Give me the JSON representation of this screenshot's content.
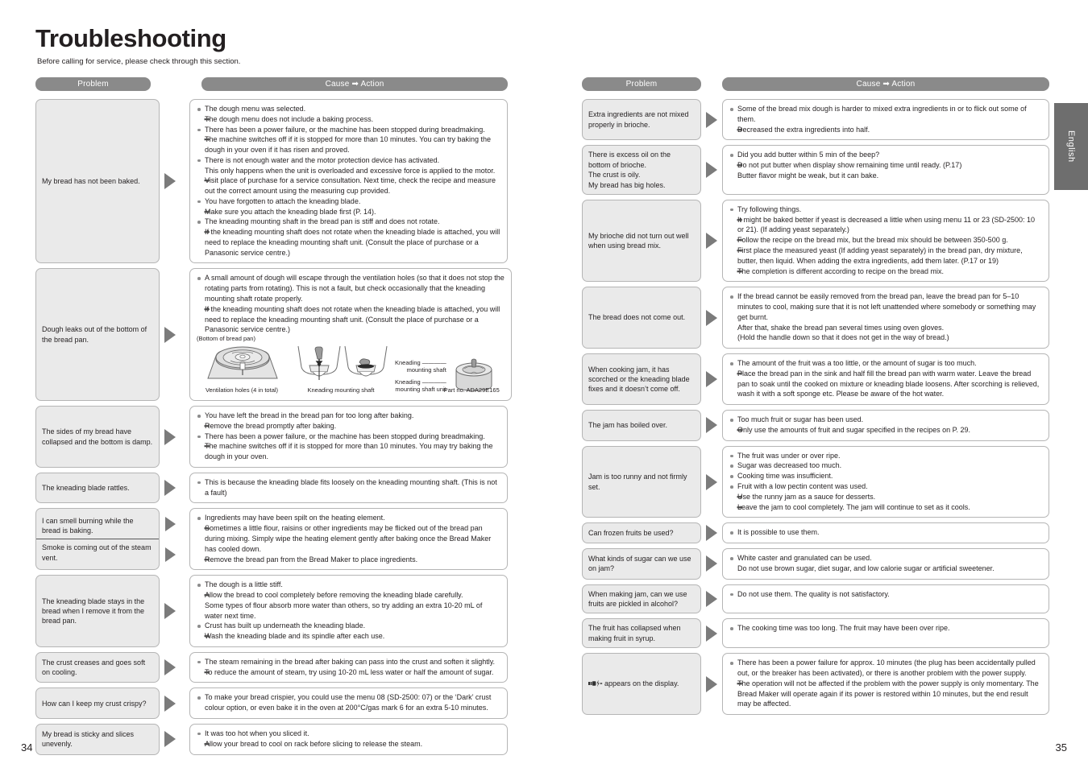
{
  "title": "Troubleshooting",
  "subtitle": "Before calling for service, please check through this section.",
  "lang_tab": "English",
  "headers": {
    "problem": "Problem",
    "cause": "Cause ➡ Action"
  },
  "page_numbers": {
    "left": "34",
    "right": "35"
  },
  "colors": {
    "header_bar": "#8a8a8a",
    "problem_box": "#eaeaea",
    "arrow": "#7b7b7b",
    "border": "#b5b5b5",
    "tab": "#6e6e6e"
  },
  "left_rows": [
    {
      "problem": [
        "My bread has not been baked."
      ],
      "items": [
        {
          "type": "cause",
          "text": "The dough menu was selected."
        },
        {
          "type": "action",
          "text": "The dough menu does not include a baking process."
        },
        {
          "type": "cause",
          "text": "There has been a power failure, or the machine has been stopped during breadmaking."
        },
        {
          "type": "action",
          "text": "The machine switches off if it is stopped for more than 10 minutes. You can try baking the dough in your oven if it has risen and proved."
        },
        {
          "type": "cause",
          "text": "There is not enough water and the motor protection device has activated."
        },
        {
          "type": "cont",
          "text": "This only happens when the unit is overloaded and excessive force is applied to the motor."
        },
        {
          "type": "action",
          "text": "Visit place of purchase for a service consultation. Next time, check the recipe and measure out the correct amount using the measuring cup provided."
        },
        {
          "type": "cause",
          "text": "You have forgotten to attach the kneading blade."
        },
        {
          "type": "action",
          "text": "Make sure you attach the kneading blade first (P. 14)."
        },
        {
          "type": "cause",
          "text": "The kneading mounting shaft in the bread pan is stiff and does not rotate."
        },
        {
          "type": "action",
          "text": "If the kneading mounting shaft does not rotate when the kneading blade is attached, you will need to replace the kneading mounting shaft unit. (Consult the place of purchase or a Panasonic service centre.)"
        }
      ]
    },
    {
      "problem": [
        "Dough leaks out of the bottom of the bread pan."
      ],
      "items": [
        {
          "type": "cause",
          "text": "A small amount of dough will escape through the ventilation holes (so that it does not stop the rotating parts from rotating). This is not a fault, but check occasionally that the kneading mounting shaft rotate properly."
        },
        {
          "type": "action",
          "text": "If the kneading mounting shaft does not rotate when the kneading blade is attached, you will need to replace the kneading mounting shaft unit. (Consult the place of purchase or a Panasonic service centre.)"
        }
      ],
      "figure": {
        "caption_top": "(Bottom of bread pan)",
        "label_1": "Ventilation holes (4 in total)",
        "label_2": "Kneading mounting shaft",
        "callout_1": "Kneading mounting shaft",
        "callout_2": "Kneading mounting shaft unit",
        "part_no": "Part no. ADA29E165"
      }
    },
    {
      "problem": [
        "The sides of my bread have collapsed and the bottom is damp."
      ],
      "items": [
        {
          "type": "cause",
          "text": "You have left the bread in the bread pan for too long after baking."
        },
        {
          "type": "action",
          "text": "Remove the bread promptly after baking."
        },
        {
          "type": "cause",
          "text": "There has been a power failure, or the machine has been stopped during breadmaking."
        },
        {
          "type": "action",
          "text": "The machine switches off if it is stopped for more than 10 minutes. You may try baking the dough in your oven."
        }
      ]
    },
    {
      "problem": [
        "The kneading blade rattles."
      ],
      "items": [
        {
          "type": "cause",
          "text": "This is because the kneading blade fits loosely on the kneading mounting shaft. (This is not a fault)"
        }
      ]
    },
    {
      "problem": [
        "I can smell burning while the bread is baking.",
        "Smoke is coming out of the steam vent."
      ],
      "split": true,
      "items": [
        {
          "type": "cause",
          "text": "Ingredients may have been spilt on the heating element."
        },
        {
          "type": "action",
          "text": "Sometimes a little flour, raisins or other ingredients may be flicked out of the bread pan during mixing. Simply wipe the heating element gently after baking once the Bread Maker has cooled down."
        },
        {
          "type": "action",
          "text": "Remove the bread pan from the Bread Maker to place ingredients."
        }
      ]
    },
    {
      "problem": [
        "The kneading blade stays in the bread when I remove it from the bread pan."
      ],
      "items": [
        {
          "type": "cause",
          "text": "The dough is a little stiff."
        },
        {
          "type": "action",
          "text": "Allow the bread to cool completely before removing the kneading blade carefully."
        },
        {
          "type": "actcont",
          "text": "Some types of flour absorb more water than others, so try adding an extra 10-20 mL of water next time."
        },
        {
          "type": "cause",
          "text": "Crust has built up underneath the kneading blade."
        },
        {
          "type": "action",
          "text": "Wash the kneading blade and its spindle after each use."
        }
      ]
    },
    {
      "problem": [
        "The crust creases and goes soft on cooling."
      ],
      "items": [
        {
          "type": "cause",
          "text": "The steam remaining in the bread after baking can pass into the crust and soften it slightly."
        },
        {
          "type": "action",
          "text": "To reduce the amount of steam, try using 10-20 mL less water or half the amount of sugar."
        }
      ]
    },
    {
      "problem": [
        "How can I keep my crust crispy?"
      ],
      "items": [
        {
          "type": "cause",
          "text": "To make your bread crispier, you could use the menu 08 (SD-2500: 07) or the ‘Dark’ crust colour option, or even bake it in the oven at 200°C/gas mark 6 for an extra 5-10 minutes."
        }
      ]
    },
    {
      "problem": [
        "My bread is sticky and slices unevenly."
      ],
      "items": [
        {
          "type": "cause",
          "text": "It was too hot when you sliced it."
        },
        {
          "type": "action",
          "text": "Allow your bread to cool on rack before slicing to release the steam."
        }
      ]
    }
  ],
  "right_rows": [
    {
      "problem": [
        "Extra ingredients are not mixed properly in brioche."
      ],
      "items": [
        {
          "type": "cause",
          "text": "Some of the bread mix dough is harder to mixed extra ingredients in or to flick out some of them."
        },
        {
          "type": "action",
          "text": "Decreased the extra ingredients into half."
        }
      ]
    },
    {
      "problem": [
        "There is excess oil on the bottom of brioche.",
        "The crust is oily.",
        "My bread has big holes."
      ],
      "multiline": true,
      "items": [
        {
          "type": "cause",
          "text": "Did you add butter within 5 min of the beep?"
        },
        {
          "type": "action",
          "text": "Do not put butter when display show remaining time until ready. (P.17)"
        },
        {
          "type": "actcont",
          "text": "Butter flavor might be weak, but it can bake."
        }
      ]
    },
    {
      "problem": [
        "My brioche did not turn out well when using bread mix."
      ],
      "items": [
        {
          "type": "cause",
          "text": "Try following things."
        },
        {
          "type": "action",
          "text": "It might be baked better if yeast is decreased a little when using menu 11 or 23 (SD-2500: 10 or 21). (If adding yeast separately.)"
        },
        {
          "type": "action",
          "text": "Follow the recipe on the bread mix, but the bread mix should be between 350-500 g."
        },
        {
          "type": "action",
          "text": "First place the measured yeast (If adding yeast separately) in the bread pan, dry mixture, butter, then liquid. When adding the extra ingredients, add them later. (P.17 or 19)"
        },
        {
          "type": "action",
          "text": "The completion is different according to recipe on the bread mix."
        }
      ]
    },
    {
      "problem": [
        "The bread does not come out."
      ],
      "items": [
        {
          "type": "cause",
          "text": "If the bread cannot be easily removed from the bread pan, leave the bread pan for 5–10 minutes to cool, making sure that it is not left unattended where somebody or something may get burnt."
        },
        {
          "type": "cont",
          "text": "After that, shake the bread pan several times using oven gloves."
        },
        {
          "type": "cont",
          "text": "(Hold the handle down so that it does not get in the way of bread.)"
        }
      ]
    },
    {
      "problem": [
        "When cooking jam, it has scorched or the kneading blade fixes and it doesn’t come off."
      ],
      "items": [
        {
          "type": "cause",
          "text": "The amount of the fruit was a too little, or the amount of sugar is too much."
        },
        {
          "type": "action",
          "text": "Place the bread pan in the sink and half fill the bread pan with warm water. Leave the bread pan to soak until the cooked on mixture or kneading blade loosens. After scorching is relieved, wash it with a soft sponge etc. Please be aware of the hot water."
        }
      ]
    },
    {
      "problem": [
        "The jam has boiled over."
      ],
      "items": [
        {
          "type": "cause",
          "text": "Too much fruit or sugar has been used."
        },
        {
          "type": "action",
          "text": "Only use the amounts of fruit and sugar specified in the recipes on P. 29."
        }
      ]
    },
    {
      "problem": [
        "Jam is too runny and not firmly set."
      ],
      "items": [
        {
          "type": "cause",
          "text": "The fruit was under or over ripe."
        },
        {
          "type": "cause",
          "text": "Sugar was decreased too much."
        },
        {
          "type": "cause",
          "text": "Cooking time was insufficient."
        },
        {
          "type": "cause",
          "text": "Fruit with a low pectin content was used."
        },
        {
          "type": "action",
          "text": "Use the runny jam as a sauce for desserts."
        },
        {
          "type": "action",
          "text": "Leave the jam to cool completely. The jam will continue to set as it cools."
        }
      ]
    },
    {
      "problem": [
        "Can frozen fruits be used?"
      ],
      "items": [
        {
          "type": "cause",
          "text": "It is possible to use them."
        }
      ]
    },
    {
      "problem": [
        "What kinds of sugar can we use on jam?"
      ],
      "items": [
        {
          "type": "cause",
          "text": "White caster and granulated can be used."
        },
        {
          "type": "cont",
          "text": "Do not use brown sugar, diet sugar, and low calorie sugar or artificial sweetener."
        }
      ]
    },
    {
      "problem": [
        "When making jam, can we use fruits are pickled in alcohol?"
      ],
      "items": [
        {
          "type": "cause",
          "text": "Do not use them. The quality is not satisfactory."
        }
      ]
    },
    {
      "problem": [
        "The fruit has collapsed when making fruit in syrup."
      ],
      "items": [
        {
          "type": "cause",
          "text": "The cooking time was too long. The fruit may have been over ripe."
        }
      ]
    },
    {
      "problem": [
        "appears on the display."
      ],
      "has_plug_icon": true,
      "items": [
        {
          "type": "cause",
          "text": "There has been a power failure for approx. 10 minutes (the plug has been accidentally pulled out, or the breaker has been activated), or there is another problem with the power supply."
        },
        {
          "type": "action",
          "text": "The operation will not be affected if the problem with the power supply is only momentary. The Bread Maker will operate again if its power is restored within 10 minutes, but the end result may be affected."
        }
      ]
    }
  ]
}
